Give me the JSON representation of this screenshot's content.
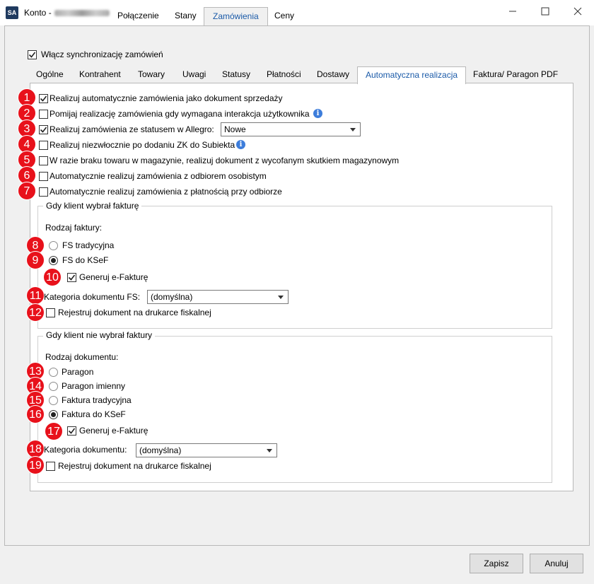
{
  "window": {
    "app_icon": "SA",
    "title": "Konto -",
    "tabs": [
      "Połączenie",
      "Stany",
      "Zamówienia",
      "Ceny"
    ],
    "active_tab": "Zamówienia"
  },
  "sync": {
    "label": "Włącz synchronizację zamówień",
    "checked": true
  },
  "subtabs": [
    "Ogólne",
    "Kontrahent",
    "Towary",
    "Uwagi",
    "Statusy",
    "Płatności",
    "Dostawy",
    "Automatyczna realizacja",
    "Faktura/ Paragon PDF"
  ],
  "active_subtab": "Automatyczna realizacja",
  "badges": [
    "1",
    "2",
    "3",
    "4",
    "5",
    "6",
    "7",
    "8",
    "9",
    "10",
    "11",
    "12",
    "13",
    "14",
    "15",
    "16",
    "17",
    "18",
    "19"
  ],
  "options": [
    {
      "label": "Realizuj automatycznie zamówienia jako dokument sprzedaży",
      "checked": true
    },
    {
      "label": "Pomijaj realizację zamówienia gdy wymagana interakcja użytkownika",
      "checked": false
    },
    {
      "label": "Realizuj zamówienia ze statusem w Allegro:",
      "checked": true
    },
    {
      "label": "Realizuj niezwłocznie po dodaniu ZK do Subiekta",
      "checked": false
    },
    {
      "label": "W razie braku towaru w magazynie, realizuj dokument z wycofanym skutkiem magazynowym",
      "checked": false
    },
    {
      "label": "Automatycznie realizuj zamówienia z odbiorem osobistym",
      "checked": false
    },
    {
      "label": "Automatycznie realizuj zamówienia z płatnością przy odbiorze",
      "checked": false
    }
  ],
  "status_dropdown": {
    "value": "Nowe"
  },
  "invoice_group": {
    "title": "Gdy klient wybrał fakturę",
    "type_label": "Rodzaj faktury:",
    "radios": [
      {
        "label": "FS tradycyjna",
        "selected": false
      },
      {
        "label": "FS do KSeF",
        "selected": true
      }
    ],
    "einvoice": {
      "label": "Generuj e-Fakturę",
      "checked": true
    },
    "category_label": "Kategoria dokumentu FS:",
    "category_value": "(domyślna)",
    "fiscal": {
      "label": "Rejestruj dokument na drukarce fiskalnej",
      "checked": false
    }
  },
  "noinvoice_group": {
    "title": "Gdy klient nie wybrał faktury",
    "type_label": "Rodzaj dokumentu:",
    "radios": [
      {
        "label": "Paragon",
        "selected": false
      },
      {
        "label": "Paragon imienny",
        "selected": false
      },
      {
        "label": "Faktura tradycyjna",
        "selected": false
      },
      {
        "label": "Faktura do KSeF",
        "selected": true
      }
    ],
    "einvoice": {
      "label": "Generuj e-Fakturę",
      "checked": true
    },
    "category_label": "Kategoria dokumentu:",
    "category_value": "(domyślna)",
    "fiscal": {
      "label": "Rejestruj dokument na drukarce fiskalnej",
      "checked": false
    }
  },
  "buttons": {
    "save": "Zapisz",
    "cancel": "Anuluj"
  },
  "icons": {
    "info": "i"
  },
  "colors": {
    "badge": "#e8111b",
    "accent": "#1a5aa8",
    "info": "#3d7ddb"
  }
}
